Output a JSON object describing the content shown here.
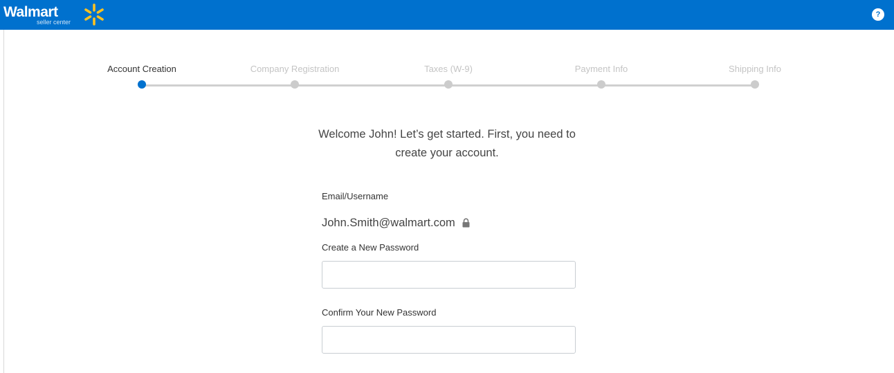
{
  "header": {
    "brand": "Walmart",
    "brand_sub": "seller center",
    "help_label": "?",
    "accent_color": "#0071ce",
    "spark_color": "#ffc220"
  },
  "stepper": {
    "steps": [
      {
        "label": "Account Creation",
        "state": "active"
      },
      {
        "label": "Company Registration",
        "state": "pending"
      },
      {
        "label": "Taxes (W-9)",
        "state": "pending"
      },
      {
        "label": "Payment Info",
        "state": "pending"
      },
      {
        "label": "Shipping Info",
        "state": "pending"
      }
    ]
  },
  "welcome": {
    "line1": "Welcome John! Let’s get started. First, you need to",
    "line2": "create your account."
  },
  "form": {
    "email_label": "Email/Username",
    "email_value": "John.Smith@walmart.com",
    "email_icon": "lock-icon",
    "password_label": "Create a New Password",
    "password_value": "",
    "confirm_label": "Confirm Your New Password",
    "confirm_value": ""
  }
}
